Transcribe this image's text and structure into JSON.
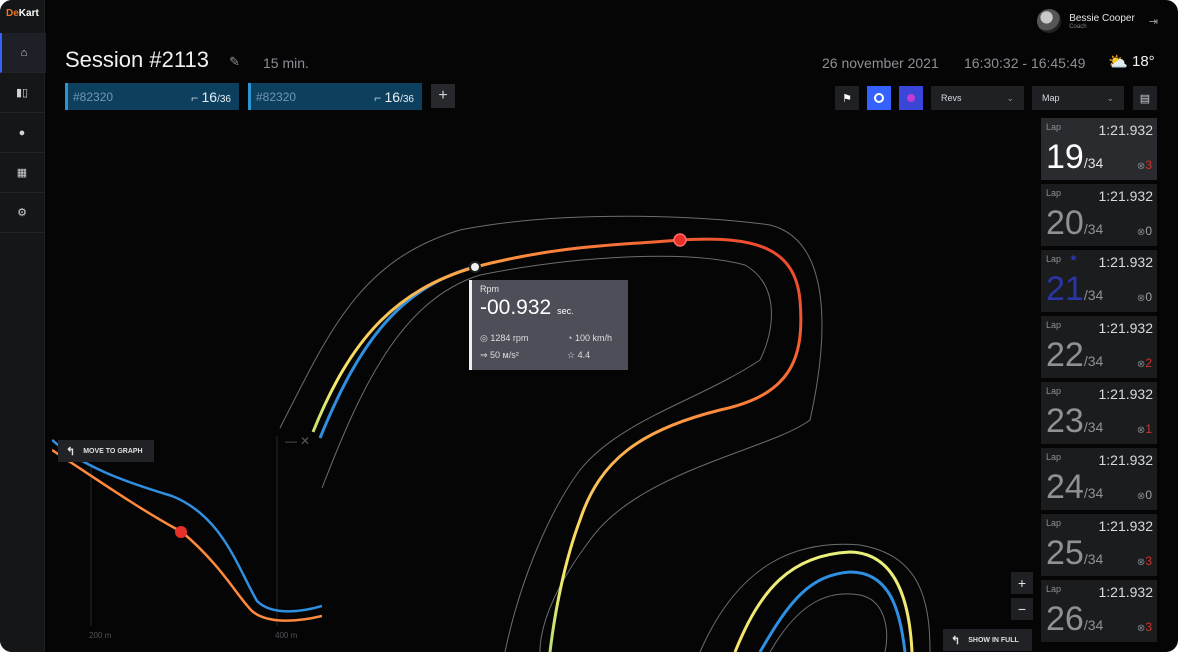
{
  "app": {
    "logo_prefix": "De",
    "logo_suffix": "Kart"
  },
  "sidebar": {
    "items": [
      {
        "icon": "home-icon"
      },
      {
        "icon": "karts-icon"
      },
      {
        "icon": "user-icon"
      },
      {
        "icon": "table-icon"
      },
      {
        "icon": "gear-icon"
      }
    ]
  },
  "user": {
    "name": "Bessie Cooper",
    "role": "Coach"
  },
  "session": {
    "title": "Session #2113",
    "duration": "15 min.",
    "date": "26 november 2021",
    "time_range": "16:30:32 - 16:45:49",
    "temperature": "18°"
  },
  "karts": [
    {
      "id": "#82320",
      "lap": "16",
      "total": "/36"
    },
    {
      "id": "#82320",
      "lap": "16",
      "total": "/36"
    }
  ],
  "toolbar": {
    "add_label": "+",
    "flag_color": "#ffffff",
    "toggle_on_color": "#3561ff",
    "selects": [
      {
        "value": "Revs"
      },
      {
        "value": "Map"
      }
    ]
  },
  "tooltip": {
    "title": "Rpm",
    "value": "-00.932",
    "unit": "sec.",
    "rpm": "1284 rpm",
    "speed": "100 km/h",
    "accel": "50 м/s²",
    "rating": "4.4"
  },
  "laps": [
    {
      "label": "Lap",
      "time": "1:21.932",
      "number": "19",
      "total": "/34",
      "errors": "3",
      "errors_red": true,
      "favorite": false,
      "current": true
    },
    {
      "label": "Lap",
      "time": "1:21.932",
      "number": "20",
      "total": "/34",
      "errors": "0",
      "errors_red": false,
      "favorite": false,
      "current": false
    },
    {
      "label": "Lap",
      "time": "1:21.932",
      "number": "21",
      "total": "/34",
      "errors": "0",
      "errors_red": false,
      "favorite": true,
      "current": false
    },
    {
      "label": "Lap",
      "time": "1:21.932",
      "number": "22",
      "total": "/34",
      "errors": "2",
      "errors_red": true,
      "favorite": false,
      "current": false
    },
    {
      "label": "Lap",
      "time": "1:21.932",
      "number": "23",
      "total": "/34",
      "errors": "1",
      "errors_red": true,
      "favorite": false,
      "current": false
    },
    {
      "label": "Lap",
      "time": "1:21.932",
      "number": "24",
      "total": "/34",
      "errors": "0",
      "errors_red": false,
      "favorite": false,
      "current": false
    },
    {
      "label": "Lap",
      "time": "1:21.932",
      "number": "25",
      "total": "/34",
      "errors": "3",
      "errors_red": true,
      "favorite": false,
      "current": false
    },
    {
      "label": "Lap",
      "time": "1:21.932",
      "number": "26",
      "total": "/34",
      "errors": "3",
      "errors_red": true,
      "favorite": false,
      "current": false
    }
  ],
  "graph": {
    "move_label": "MOVE TO GRAPH",
    "axis_labels": [
      "200 m",
      "400 m"
    ]
  },
  "map": {
    "show_full_label": "SHOW IN FULL",
    "zoom_in": "+",
    "zoom_out": "−"
  },
  "colors": {
    "series_blue": "#2f8fe0",
    "series_orange": "#ff8a3d",
    "marker_red": "#e8302b",
    "accent": "#3561ff"
  }
}
